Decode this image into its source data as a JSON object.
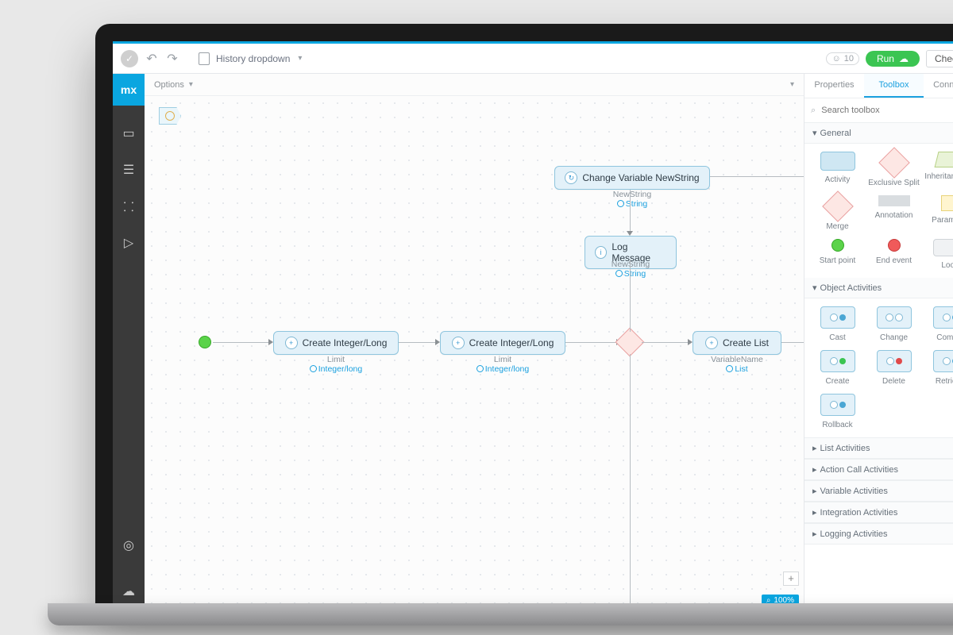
{
  "logo": "mx",
  "toolbar": {
    "history_label": "History dropdown",
    "run_label": "Run",
    "checks_label": "Checks",
    "options_label": "Options"
  },
  "user_count": "10",
  "zoom": "100%",
  "nodes": {
    "changeVar": {
      "title": "Change Variable NewString",
      "sub1": "NewString",
      "sub2": "String"
    },
    "logMsg": {
      "title": "Log Message",
      "sub1": "NewString",
      "sub2": "String"
    },
    "createIL1": {
      "title": "Create Integer/Long",
      "sub1": "Limit",
      "sub2": "Integer/long"
    },
    "createIL2": {
      "title": "Create Integer/Long",
      "sub1": "Limit",
      "sub2": "Integer/long"
    },
    "createList": {
      "title": "Create List",
      "sub1": "VariableName",
      "sub2": "List"
    }
  },
  "panel": {
    "tabs": {
      "properties": "Properties",
      "toolbox": "Toolbox",
      "connector": "Connector"
    },
    "search_placeholder": "Search toolbox",
    "sections": {
      "general": "General",
      "object": "Object Activities",
      "list": "List Activities",
      "actioncall": "Action Call Activities",
      "variable": "Variable Activities",
      "integration": "Integration Activities",
      "logging": "Logging Activities"
    },
    "general_items": {
      "activity": "Activity",
      "excl": "Exclusive Split",
      "inherit": "Inheritance Sp",
      "merge": "Merge",
      "annot": "Annotation",
      "param": "Parameter",
      "start": "Start point",
      "end": "End event",
      "loop": "Loop"
    },
    "object_items": {
      "cast": "Cast",
      "change": "Change",
      "commit": "Commit",
      "create": "Create",
      "delete": "Delete",
      "retrieve": "Retrieve",
      "rollback": "Rollback"
    }
  }
}
